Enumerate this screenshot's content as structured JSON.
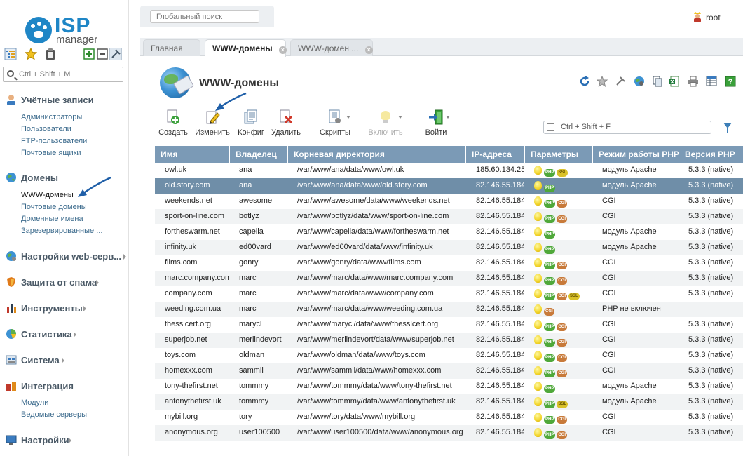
{
  "app": {
    "logo_top": "ISP",
    "logo_bottom": "manager"
  },
  "sidebar": {
    "search_placeholder": "Ctrl + Shift + M",
    "groups": [
      {
        "label": "Учётные записи",
        "items": [
          "Администраторы",
          "Пользователи",
          "FTP-пользователи",
          "Почтовые ящики"
        ]
      },
      {
        "label": "Домены",
        "items": [
          "WWW-домены",
          "Почтовые домены",
          "Доменные имена",
          "Зарезервированные ..."
        ]
      },
      {
        "label": "Настройки web-серв..."
      },
      {
        "label": "Защита от спама"
      },
      {
        "label": "Инструменты"
      },
      {
        "label": "Статистика"
      },
      {
        "label": "Система"
      },
      {
        "label": "Интеграция",
        "items": [
          "Модули",
          "Ведомые серверы"
        ]
      },
      {
        "label": "Настройки"
      }
    ]
  },
  "topbar": {
    "global_search_placeholder": "Глобальный поиск",
    "user": "root"
  },
  "tabs": [
    "Главная",
    "WWW-домены",
    "WWW-домен ..."
  ],
  "page": {
    "title": "WWW-домены"
  },
  "toolbar": {
    "create": "Создать",
    "edit": "Изменить",
    "config": "Конфиг",
    "delete": "Удалить",
    "scripts": "Скрипты",
    "enable": "Включить",
    "login": "Войти",
    "filter_placeholder": "Ctrl + Shift + F"
  },
  "table": {
    "columns": [
      "Имя",
      "Владелец",
      "Корневая директория",
      "IP-адреса",
      "Параметры",
      "Режим работы PHP",
      "Версия PHP"
    ],
    "rows": [
      {
        "name": "owl.uk",
        "owner": "ana",
        "root": "/var/www/ana/data/www/owl.uk",
        "ip": "185.60.134.25",
        "params": [
          "php",
          "ssl"
        ],
        "mode": "модуль Apache",
        "version": "5.3.3 (native)"
      },
      {
        "name": "old.story.com",
        "owner": "ana",
        "root": "/var/www/ana/data/www/old.story.com",
        "ip": "82.146.55.184",
        "params": [
          "php"
        ],
        "mode": "модуль Apache",
        "version": "5.3.3 (native)"
      },
      {
        "name": "weekends.net",
        "owner": "awesome",
        "root": "/var/www/awesome/data/www/weekends.net",
        "ip": "82.146.55.184",
        "params": [
          "php",
          "cgi"
        ],
        "mode": "CGI",
        "version": "5.3.3 (native)"
      },
      {
        "name": "sport-on-line.com",
        "owner": "botlyz",
        "root": "/var/www/botlyz/data/www/sport-on-line.com",
        "ip": "82.146.55.184",
        "params": [
          "php",
          "cgi"
        ],
        "mode": "CGI",
        "version": "5.3.3 (native)"
      },
      {
        "name": "fortheswarm.net",
        "owner": "capella",
        "root": "/var/www/capella/data/www/fortheswarm.net",
        "ip": "82.146.55.184",
        "params": [
          "php"
        ],
        "mode": "модуль Apache",
        "version": "5.3.3 (native)"
      },
      {
        "name": "infinity.uk",
        "owner": "ed00vard",
        "root": "/var/www/ed00vard/data/www/infinity.uk",
        "ip": "82.146.55.184",
        "params": [
          "php"
        ],
        "mode": "модуль Apache",
        "version": "5.3.3 (native)"
      },
      {
        "name": "films.com",
        "owner": "gonry",
        "root": "/var/www/gonry/data/www/films.com",
        "ip": "82.146.55.184",
        "params": [
          "php",
          "cgi"
        ],
        "mode": "CGI",
        "version": "5.3.3 (native)"
      },
      {
        "name": "marc.company.com",
        "owner": "marc",
        "root": "/var/www/marc/data/www/marc.company.com",
        "ip": "82.146.55.184",
        "params": [
          "php",
          "cgi"
        ],
        "mode": "CGI",
        "version": "5.3.3 (native)"
      },
      {
        "name": "company.com",
        "owner": "marc",
        "root": "/var/www/marc/data/www/company.com",
        "ip": "82.146.55.184",
        "params": [
          "php",
          "cgi",
          "ssl"
        ],
        "mode": "CGI",
        "version": "5.3.3 (native)"
      },
      {
        "name": "weeding.com.ua",
        "owner": "marc",
        "root": "/var/www/marc/data/www/weeding.com.ua",
        "ip": "82.146.55.184",
        "params": [
          "cgi"
        ],
        "mode": "PHP не включен",
        "version": ""
      },
      {
        "name": "thesslcert.org",
        "owner": "marycl",
        "root": "/var/www/marycl/data/www/thesslcert.org",
        "ip": "82.146.55.184",
        "params": [
          "php",
          "cgi"
        ],
        "mode": "CGI",
        "version": "5.3.3 (native)"
      },
      {
        "name": "superjob.net",
        "owner": "merlindevort",
        "root": "/var/www/merlindevort/data/www/superjob.net",
        "ip": "82.146.55.184",
        "params": [
          "php",
          "cgi"
        ],
        "mode": "CGI",
        "version": "5.3.3 (native)"
      },
      {
        "name": "toys.com",
        "owner": "oldman",
        "root": "/var/www/oldman/data/www/toys.com",
        "ip": "82.146.55.184",
        "params": [
          "php",
          "cgi"
        ],
        "mode": "CGI",
        "version": "5.3.3 (native)"
      },
      {
        "name": "homexxx.com",
        "owner": "sammii",
        "root": "/var/www/sammii/data/www/homexxx.com",
        "ip": "82.146.55.184",
        "params": [
          "php",
          "cgi"
        ],
        "mode": "CGI",
        "version": "5.3.3 (native)"
      },
      {
        "name": "tony-thefirst.net",
        "owner": "tommmy",
        "root": "/var/www/tommmy/data/www/tony-thefirst.net",
        "ip": "82.146.55.184",
        "params": [
          "php"
        ],
        "mode": "модуль Apache",
        "version": "5.3.3 (native)"
      },
      {
        "name": "antonythefirst.uk",
        "owner": "tommmy",
        "root": "/var/www/tommmy/data/www/antonythefirst.uk",
        "ip": "82.146.55.184",
        "params": [
          "php",
          "ssl"
        ],
        "mode": "модуль Apache",
        "version": "5.3.3 (native)"
      },
      {
        "name": "mybill.org",
        "owner": "tory",
        "root": "/var/www/tory/data/www/mybill.org",
        "ip": "82.146.55.184",
        "params": [
          "php",
          "cgi"
        ],
        "mode": "CGI",
        "version": "5.3.3 (native)"
      },
      {
        "name": "anonymous.org",
        "owner": "user100500",
        "root": "/var/www/user100500/data/www/anonymous.org",
        "ip": "82.146.55.184",
        "params": [
          "php",
          "cgi"
        ],
        "mode": "CGI",
        "version": "5.3.3 (native)"
      }
    ],
    "selected_row": 1
  },
  "colors": {
    "accent": "#1f86c6",
    "header": "#7b9ab6",
    "selected": "#6f8ea8",
    "annotation": "#1f5fa8"
  }
}
